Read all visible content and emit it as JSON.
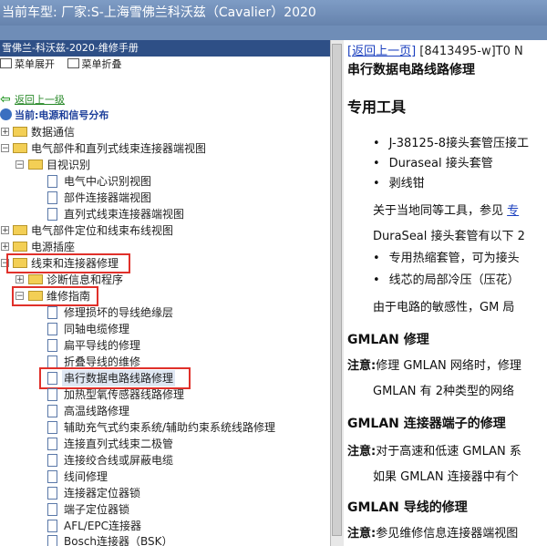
{
  "window": {
    "title": "当前车型:   厂家:S-上海雪佛兰科沃兹（Cavalier）2020"
  },
  "left_panel": {
    "header": "雪佛兰-科沃兹-2020-维修手册",
    "toolbar": {
      "expand_label": "菜单展开",
      "collapse_label": "菜单折叠"
    },
    "back_label": "返回上一级",
    "current_label": "当前:电源和信号分布",
    "tree": [
      {
        "label": "数据通信"
      },
      {
        "label": "电气部件和直列式线束连接器端视图"
      },
      {
        "label": "目视识别"
      },
      {
        "label": "电气中心识别视图"
      },
      {
        "label": "部件连接器端视图"
      },
      {
        "label": "直列式线束连接器端视图"
      },
      {
        "label": "电气部件定位和线束布线视图"
      },
      {
        "label": "电源插座"
      },
      {
        "label": "线束和连接器修理"
      },
      {
        "label": "诊断信息和程序"
      },
      {
        "label": "维修指南"
      },
      {
        "label": "修理损坏的导线绝缘层"
      },
      {
        "label": "同轴电缆修理"
      },
      {
        "label": "扁平导线的修理"
      },
      {
        "label": "折叠导线的维修"
      },
      {
        "label": "串行数据电路线路修理"
      },
      {
        "label": "加热型氧传感器线路修理"
      },
      {
        "label": "高温线路修理"
      },
      {
        "label": "辅助充气式约束系统/辅助约束系统线路修理"
      },
      {
        "label": "连接直列式线束二极管"
      },
      {
        "label": "连接绞合线或屏蔽电缆"
      },
      {
        "label": "线间修理"
      },
      {
        "label": "连接器定位器锁"
      },
      {
        "label": "端子定位器锁"
      },
      {
        "label": "AFL/EPC连接器"
      },
      {
        "label": "Bosch连接器（BSK）"
      }
    ]
  },
  "content": {
    "top_link": "[返回上一页]",
    "doc_code": "[8413495-w]T0 N",
    "page_title": "串行数据电路线路修理",
    "section_tools": "专用工具",
    "tools": [
      "J-38125-8接头套管压接工",
      "Duraseal 接头套管",
      "剥线钳"
    ],
    "equiv_text": "关于当地同等工具，参见 专",
    "equiv_link": "专",
    "duraseal_text": "DuraSeal 接头套管有以下 2",
    "features": [
      "专用热缩套管，可为接头",
      "线芯的局部冷压（压花）"
    ],
    "sensitivity_text": "由于电路的敏感性，GM 局",
    "gmlan_repair_title": "GMLAN 修理",
    "note_label": "注意:",
    "gmlan_note": "修理 GMLAN 网络时，修理",
    "gmlan_types": "GMLAN 有 2种类型的网络",
    "gmlan_terminal_title": "GMLAN 连接器端子的修理",
    "terminal_note": "对于高速和低速 GMLAN 系",
    "terminal_text": "如果 GMLAN 连接器中有个",
    "gmlan_wire_title": "GMLAN 导线的修理",
    "wire_note": "参见维修信息连接器端视图"
  }
}
